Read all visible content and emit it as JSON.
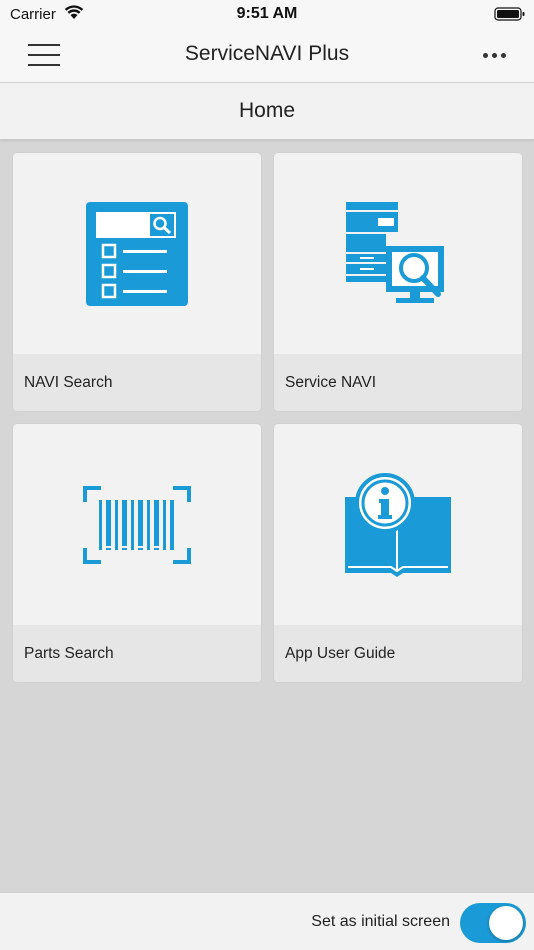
{
  "status_bar": {
    "carrier": "Carrier",
    "time": "9:51 AM"
  },
  "nav": {
    "title": "ServiceNAVI Plus",
    "menu_icon": "hamburger-icon",
    "more_icon": "ellipsis-icon"
  },
  "page": {
    "title": "Home"
  },
  "tiles": [
    {
      "label": "NAVI Search",
      "icon": "search-list-icon"
    },
    {
      "label": "Service NAVI",
      "icon": "printer-monitor-search-icon"
    },
    {
      "label": "Parts Search",
      "icon": "barcode-scan-icon"
    },
    {
      "label": "App User Guide",
      "icon": "book-info-icon"
    }
  ],
  "footer": {
    "toggle_label": "Set as initial screen",
    "toggle_on": true
  },
  "colors": {
    "accent": "#1a9ad6",
    "background": "#d6d6d6",
    "tile": "#f2f2f2",
    "tile_label": "#e6e6e6"
  }
}
